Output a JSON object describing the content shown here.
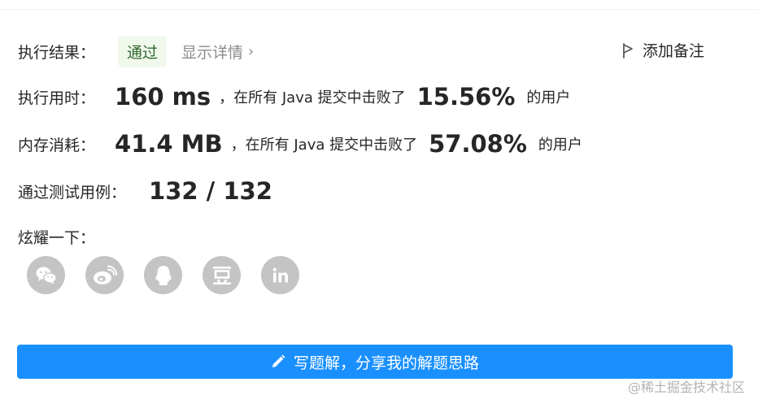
{
  "result": {
    "label": "执行结果：",
    "status": "通过",
    "details_link": "显示详情",
    "add_note": "添加备注"
  },
  "runtime": {
    "label": "执行用时：",
    "value": "160 ms",
    "prefix": "，在所有 Java 提交中击败了",
    "percent": "15.56%",
    "suffix": "的用户"
  },
  "memory": {
    "label": "内存消耗：",
    "value": "41.4 MB",
    "prefix": "，在所有 Java 提交中击败了",
    "percent": "57.08%",
    "suffix": "的用户"
  },
  "tests": {
    "label": "通过测试用例：",
    "value": "132 / 132"
  },
  "share": {
    "label": "炫耀一下：",
    "icons": [
      "wechat-icon",
      "weibo-icon",
      "qq-icon",
      "douban-icon",
      "linkedin-icon"
    ]
  },
  "write_button": {
    "label": "写题解，分享我的解题思路"
  },
  "watermark": "@稀土掘金技术社区",
  "colors": {
    "accent": "#1a90ff",
    "success_bg": "#f1f8ec",
    "success_text": "#2f6a2f",
    "muted": "#8c8c8c",
    "icon_bg": "#c4c4c4"
  }
}
